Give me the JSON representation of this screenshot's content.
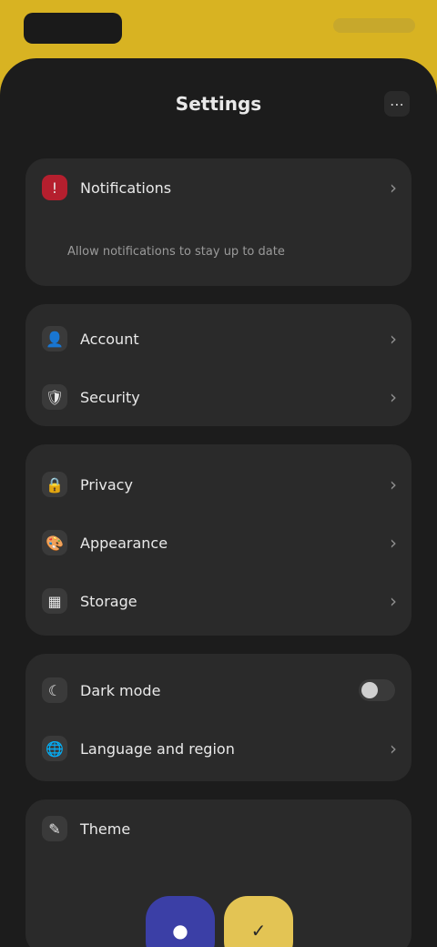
{
  "top": {
    "logo": "",
    "right_text": ""
  },
  "header": {
    "title": "Settings",
    "icon_name": "more-horizontal-icon",
    "icon_glyph": "⋯"
  },
  "alert": {
    "icon_name": "alert-icon",
    "label": "Notifications",
    "description": "Allow notifications to stay up to date"
  },
  "group1": {
    "items": [
      {
        "name": "account",
        "icon_name": "user-icon",
        "icon_glyph": "👤",
        "label": "Account"
      },
      {
        "name": "security",
        "icon_name": "shield-icon",
        "icon_glyph": "🛡",
        "label": "Security"
      }
    ]
  },
  "group2": {
    "items": [
      {
        "name": "privacy",
        "icon_name": "lock-icon",
        "icon_glyph": "🔒",
        "label": "Privacy"
      },
      {
        "name": "appearance",
        "icon_name": "palette-icon",
        "icon_glyph": "🎨",
        "label": "Appearance"
      },
      {
        "name": "storage",
        "icon_name": "storage-icon",
        "icon_glyph": "▦",
        "label": "Storage"
      }
    ]
  },
  "group3": {
    "items": [
      {
        "name": "dark-mode",
        "icon_name": "moon-icon",
        "icon_glyph": "☾",
        "label": "Dark mode"
      },
      {
        "name": "language",
        "icon_name": "globe-icon",
        "icon_glyph": "🌐",
        "label": "Language and region"
      }
    ]
  },
  "theme": {
    "label": "Theme",
    "icon_name": "brush-icon",
    "icon_glyph": "✎",
    "swatches": [
      {
        "name": "blue",
        "color": "#3b3fa6"
      },
      {
        "name": "yellow",
        "color": "#e3c454"
      }
    ]
  }
}
